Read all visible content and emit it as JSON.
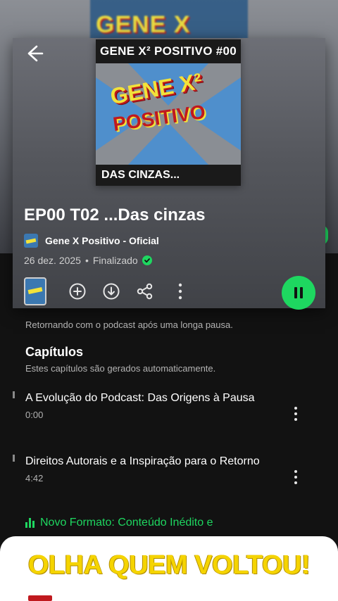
{
  "background": {
    "blur_art_text": "GENE X"
  },
  "header": {
    "back_label": "Voltar"
  },
  "cover": {
    "top_left": "GENE X² POSITIVO",
    "top_right": "#00",
    "logo_line1": "GENE X²",
    "logo_line2": "POSITIVO",
    "bottom": "DAS CINZAS..."
  },
  "episode": {
    "title": "EP00 T02 ...Das cinzas",
    "show_name": "Gene X Positivo - Oficial",
    "date": "26 dez. 2025",
    "separator": "•",
    "status": "Finalizado",
    "description": "Retornando com o podcast após uma longa pausa."
  },
  "chapters": {
    "heading": "Capítulos",
    "subheading": "Estes capítulos são gerados automaticamente.",
    "items": [
      {
        "title": "A Evolução do Podcast: Das Origens à Pausa",
        "time": "0:00"
      },
      {
        "title": "Direitos Autorais e a Inspiração para o Retorno",
        "time": "4:42"
      }
    ],
    "now_playing": "Novo Formato: Conteúdo Inédito e"
  },
  "overlay": {
    "banner_text": "OLHA QUEM VOLTOU!"
  },
  "colors": {
    "accent": "#1ed760",
    "banner_text": "#f5d400",
    "background": "#121212"
  }
}
